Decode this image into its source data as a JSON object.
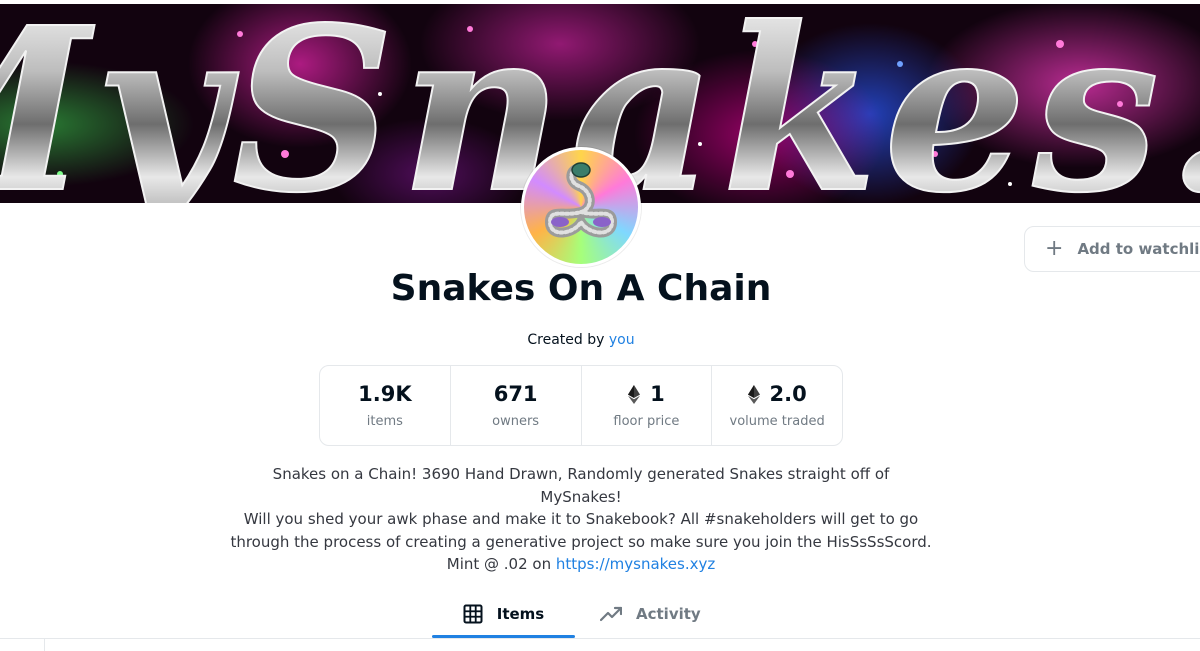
{
  "banner": {
    "text": "MySnakes.xyz",
    "colors": {
      "background": "#12030f",
      "green_glow": "#3cdc50",
      "pink_glow": "#ff28be",
      "blue_glow": "#285aff",
      "chrome": "#d9d9d9"
    }
  },
  "avatar": {
    "description_icon": "snake-avatar-icon"
  },
  "watchlist": {
    "label": "Add to watchlist",
    "icon": "plus-icon"
  },
  "collection": {
    "title": "Snakes On A Chain",
    "created_by_label": "Created by",
    "creator": "you"
  },
  "stats": [
    {
      "value": "1.9K",
      "label": "items",
      "icon": null
    },
    {
      "value": "671",
      "label": "owners",
      "icon": null
    },
    {
      "value": "1",
      "label": "floor price",
      "icon": "ethereum-icon"
    },
    {
      "value": "2.0",
      "label": "volume traded",
      "icon": "ethereum-icon"
    }
  ],
  "description": {
    "line1": "Snakes on a Chain! 3690 Hand Drawn, Randomly generated Snakes straight off of MySnakes!",
    "line2": "Will you shed your awk phase and make it to Snakebook? All #snakeholders will get to go",
    "line3": "through the process of creating a generative project so make sure you join the HisSsSsScord.",
    "line4_prefix": "Mint @ .02 on",
    "link": "https://mysnakes.xyz"
  },
  "tabs": [
    {
      "label": "Items",
      "icon": "grid-icon",
      "active": true
    },
    {
      "label": "Activity",
      "icon": "activity-chart-icon",
      "active": false
    }
  ],
  "colors": {
    "accent": "#2081e2",
    "text": "#04111d",
    "muted": "#707a83",
    "border": "#e5e8eb"
  }
}
